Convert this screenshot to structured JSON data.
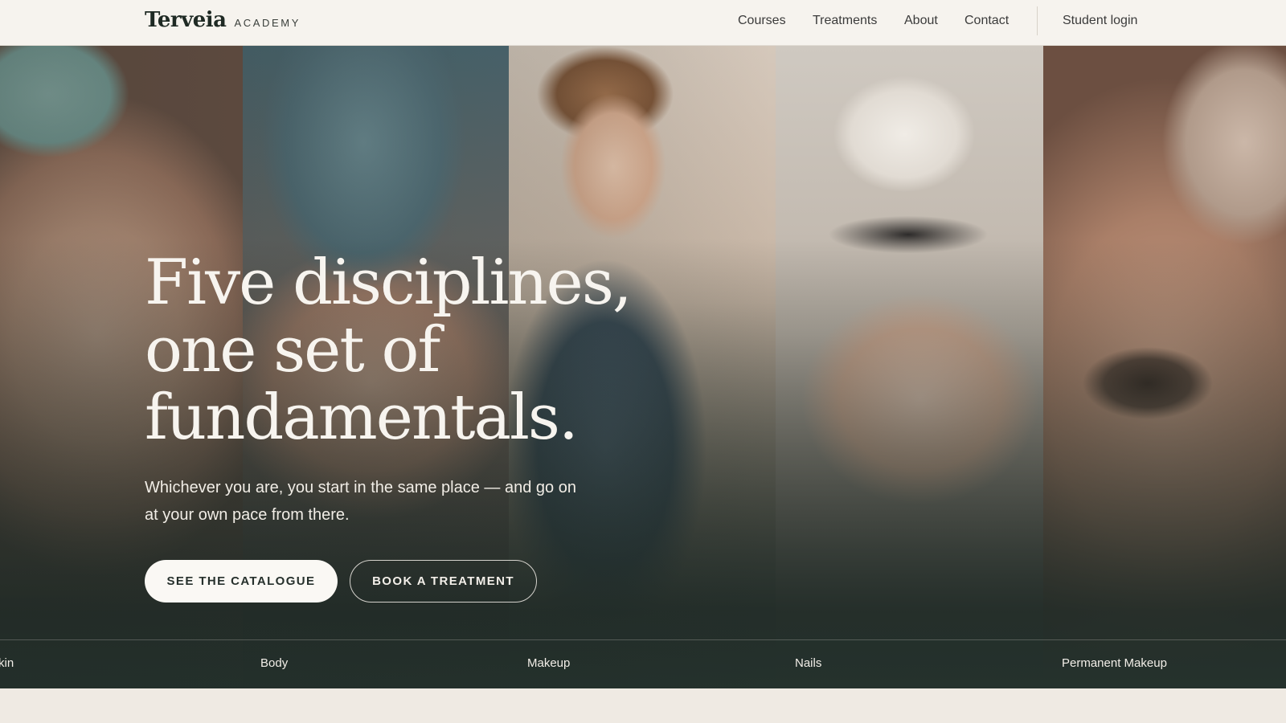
{
  "brand": {
    "name": "Terveia",
    "sub": "ACADEMY"
  },
  "nav": {
    "items": [
      {
        "label": "Courses"
      },
      {
        "label": "Treatments"
      },
      {
        "label": "About"
      },
      {
        "label": "Contact"
      }
    ],
    "login_label": "Student login"
  },
  "hero": {
    "headline_lines": [
      "Five disciplines,",
      "one set of",
      "fundamentals."
    ],
    "subhead": "Whichever you are, you start in the same place — and go on at your own pace from there.",
    "primary_cta": "SEE THE CATALOGUE",
    "secondary_cta": "BOOK A TREATMENT",
    "disciplines": [
      "kin",
      "Body",
      "Makeup",
      "Nails",
      "Permanent Makeup"
    ]
  },
  "colors": {
    "header_bg": "#f6f3ee",
    "page_bg": "#efeae3",
    "hero_dark": "#25322d",
    "text_light": "#f7f4ef"
  }
}
